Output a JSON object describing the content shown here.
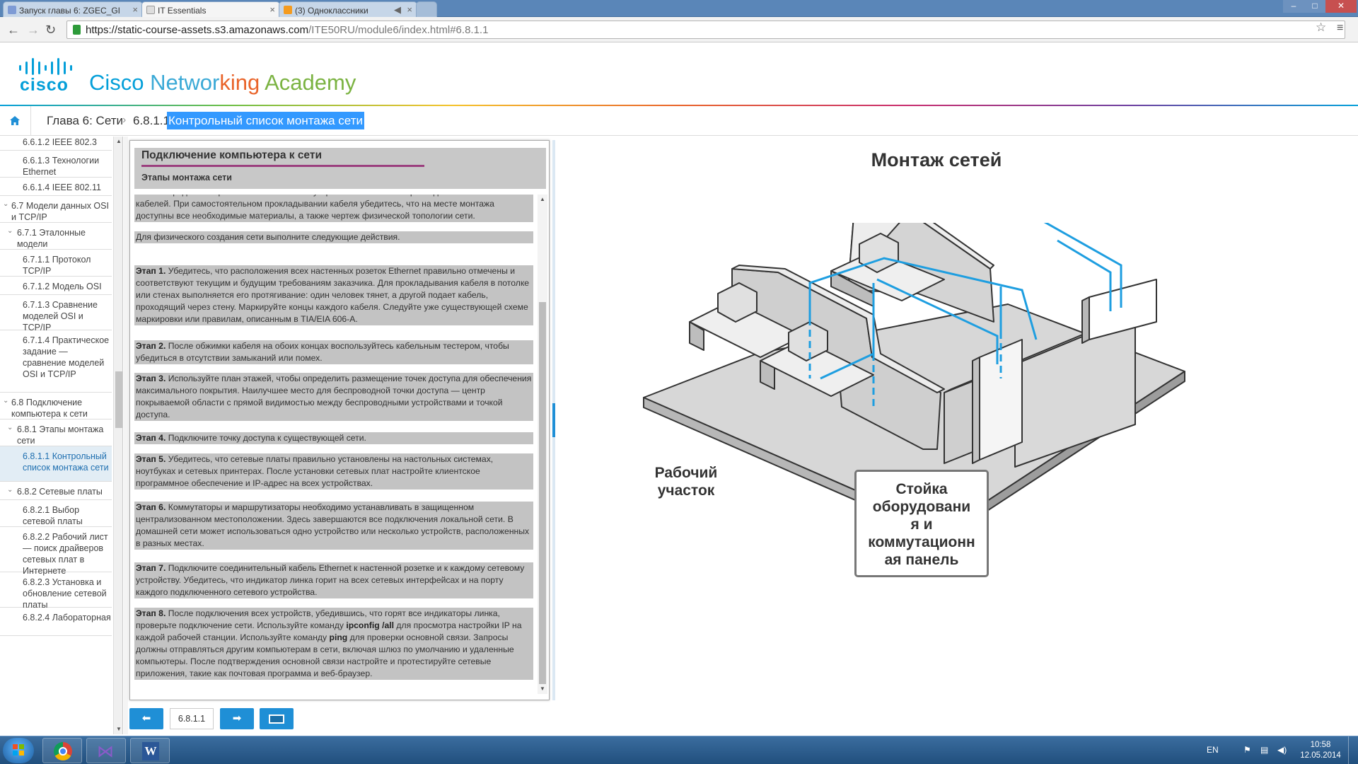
{
  "browser": {
    "tabs": [
      {
        "label": "Запуск главы 6: ZGEC_GI",
        "active": false,
        "color": "#7e9bd5"
      },
      {
        "label": "IT Essentials",
        "active": true,
        "color": "#e8e8e8"
      },
      {
        "label": "(3) Одноклассники",
        "active": false,
        "color": "#f49b1f"
      }
    ],
    "url_host": "https://static-course-assets.s3.amazonaws.com",
    "url_path": "/ITE50RU/module6/index.html#6.8.1.1"
  },
  "header": {
    "logo_text": "cisco",
    "title_parts": [
      {
        "text": "Cisco ",
        "color": "#049fd9"
      },
      {
        "text": "Networ",
        "color": "#3aa9d6"
      },
      {
        "text": "king ",
        "color": "#e9642a"
      },
      {
        "text": "Academy",
        "color": "#7bb342"
      }
    ]
  },
  "breadcrumb": {
    "chapter": "Глава 6: Сети",
    "section": "6.8.1.1",
    "current": "Контрольный список монтажа сети"
  },
  "sidebar": {
    "items": [
      {
        "label": "6.6.1.2 IEEE 802.3",
        "level": 3,
        "active": false,
        "chevron": false
      },
      {
        "label": "6.6.1.3 Технологии Ethernet",
        "level": 3,
        "active": false,
        "chevron": false
      },
      {
        "label": "6.6.1.4 IEEE 802.11",
        "level": 3,
        "active": false,
        "chevron": false
      },
      {
        "label": "6.7 Модели данных OSI и TCP/IP",
        "level": 1,
        "active": false,
        "chevron": true
      },
      {
        "label": "6.7.1 Эталонные модели",
        "level": 2,
        "active": false,
        "chevron": true
      },
      {
        "label": "6.7.1.1 Протокол TCP/IP",
        "level": 3,
        "active": false,
        "chevron": false
      },
      {
        "label": "6.7.1.2 Модель OSI",
        "level": 3,
        "active": false,
        "chevron": false
      },
      {
        "label": "6.7.1.3 Сравнение моделей OSI и TCP/IP",
        "level": 3,
        "active": false,
        "chevron": false
      },
      {
        "label": "6.7.1.4 Практическое задание — сравнение моделей OSI и TCP/IP",
        "level": 3,
        "active": false,
        "chevron": false
      },
      {
        "label": "6.8 Подключение компьютера к сети",
        "level": 1,
        "active": false,
        "chevron": true
      },
      {
        "label": "6.8.1 Этапы монтажа сети",
        "level": 2,
        "active": false,
        "chevron": true
      },
      {
        "label": "6.8.1.1 Контрольный список монтажа сети",
        "level": 3,
        "active": true,
        "chevron": false
      },
      {
        "label": "6.8.2 Сетевые платы",
        "level": 2,
        "active": false,
        "chevron": true
      },
      {
        "label": "6.8.2.1 Выбор сетевой платы",
        "level": 3,
        "active": false,
        "chevron": false
      },
      {
        "label": "6.8.2.2 Рабочий лист — поиск драйверов сетевых плат в Интернете",
        "level": 3,
        "active": false,
        "chevron": false
      },
      {
        "label": "6.8.2.3 Установка и обновление сетевой платы",
        "level": 3,
        "active": false,
        "chevron": false
      },
      {
        "label": "6.8.2.4 Лабораторная",
        "level": 3,
        "active": false,
        "chevron": false
      }
    ]
  },
  "content": {
    "title": "Подключение компьютера к сети",
    "subtitle": "Этапы монтажа сети",
    "paragraphs": [
      {
        "step": "",
        "text": "После определения расположения сетевых устройств все готово к прокладыванию сетевых кабелей. При самостоятельном прокладывании кабеля убедитесь, что на месте монтажа доступны все необходимые материалы, а также чертеж физической топологии сети."
      },
      {
        "step": "",
        "text": "Для физического создания сети выполните следующие действия."
      },
      {
        "step": "Этап 1.",
        "text": "Убедитесь, что расположения всех настенных розеток Ethernet правильно отмечены и соответствуют текущим и будущим требованиям заказчика. Для прокладывания кабеля в потолке или стенах выполняется его протягивание: один человек тянет, а другой подает кабель, проходящий через стену. Маркируйте концы каждого кабеля. Следуйте уже существующей схеме маркировки или правилам, описанным в TIA/EIA 606-A."
      },
      {
        "step": "Этап 2.",
        "text": "После обжимки кабеля на обоих концах воспользуйтесь кабельным тестером, чтобы убедиться в отсутствии замыканий или помех."
      },
      {
        "step": "Этап 3.",
        "text": "Используйте план этажей, чтобы определить размещение точек доступа для обеспечения максимального покрытия. Наилучшее место для беспроводной точки доступа — центр покрываемой области с прямой видимостью между беспроводными устройствами и точкой доступа."
      },
      {
        "step": "Этап 4.",
        "text": "Подключите точку доступа к существующей сети."
      },
      {
        "step": "Этап 5.",
        "text": "Убедитесь, что сетевые платы правильно установлены на настольных системах, ноутбуках и сетевых принтерах. После установки сетевых плат настройте клиентское программное обеспечение и IP-адрес на всех устройствах."
      },
      {
        "step": "Этап 6.",
        "text": "Коммутаторы и маршрутизаторы необходимо устанавливать в защищенном централизованном местоположении. Здесь завершаются все подключения локальной сети. В домашней сети может использоваться одно устройство или несколько устройств, расположенных в разных местах."
      },
      {
        "step": "Этап 7.",
        "text": "Подключите соединительный кабель Ethernet к настенной розетке и к каждому сетевому устройству. Убедитесь, что индикатор линка горит на всех сетевых интерфейсах и на порту каждого подключенного сетевого устройства."
      }
    ],
    "step8": {
      "step": "Этап 8.",
      "t1": "После подключения всех устройств, убедившись, что горят все индикаторы линка, проверьте подключение сети. Используйте команду ",
      "cmd1": "ipconfig /all",
      "t2": " для просмотра настройки IP на каждой рабочей станции. Используйте команду ",
      "cmd2": "ping",
      "t3": " для проверки основной связи. Запросы должны отправляться другим компьютерам в сети, включая шлюз по умолчанию и удаленные компьютеры. После подтверждения основной связи настройте и протестируйте сетевые приложения, такие как почтовая программа и веб-браузер."
    }
  },
  "navigation": {
    "page_number": "6.8.1.1",
    "prev_icon": "arrow-left-icon",
    "next_icon": "arrow-right-icon",
    "fullscreen_icon": "screen-icon"
  },
  "figure": {
    "title": "Монтаж сетей",
    "label_workspace": "Рабочий участок",
    "label_rack_lines": [
      "Стойка",
      "оборудовани",
      "я и",
      "коммутационн",
      "ая панель"
    ],
    "cable_color": "#1e9ee0"
  },
  "taskbar": {
    "lang": "EN",
    "time": "10:58",
    "date": "12.05.2014"
  }
}
